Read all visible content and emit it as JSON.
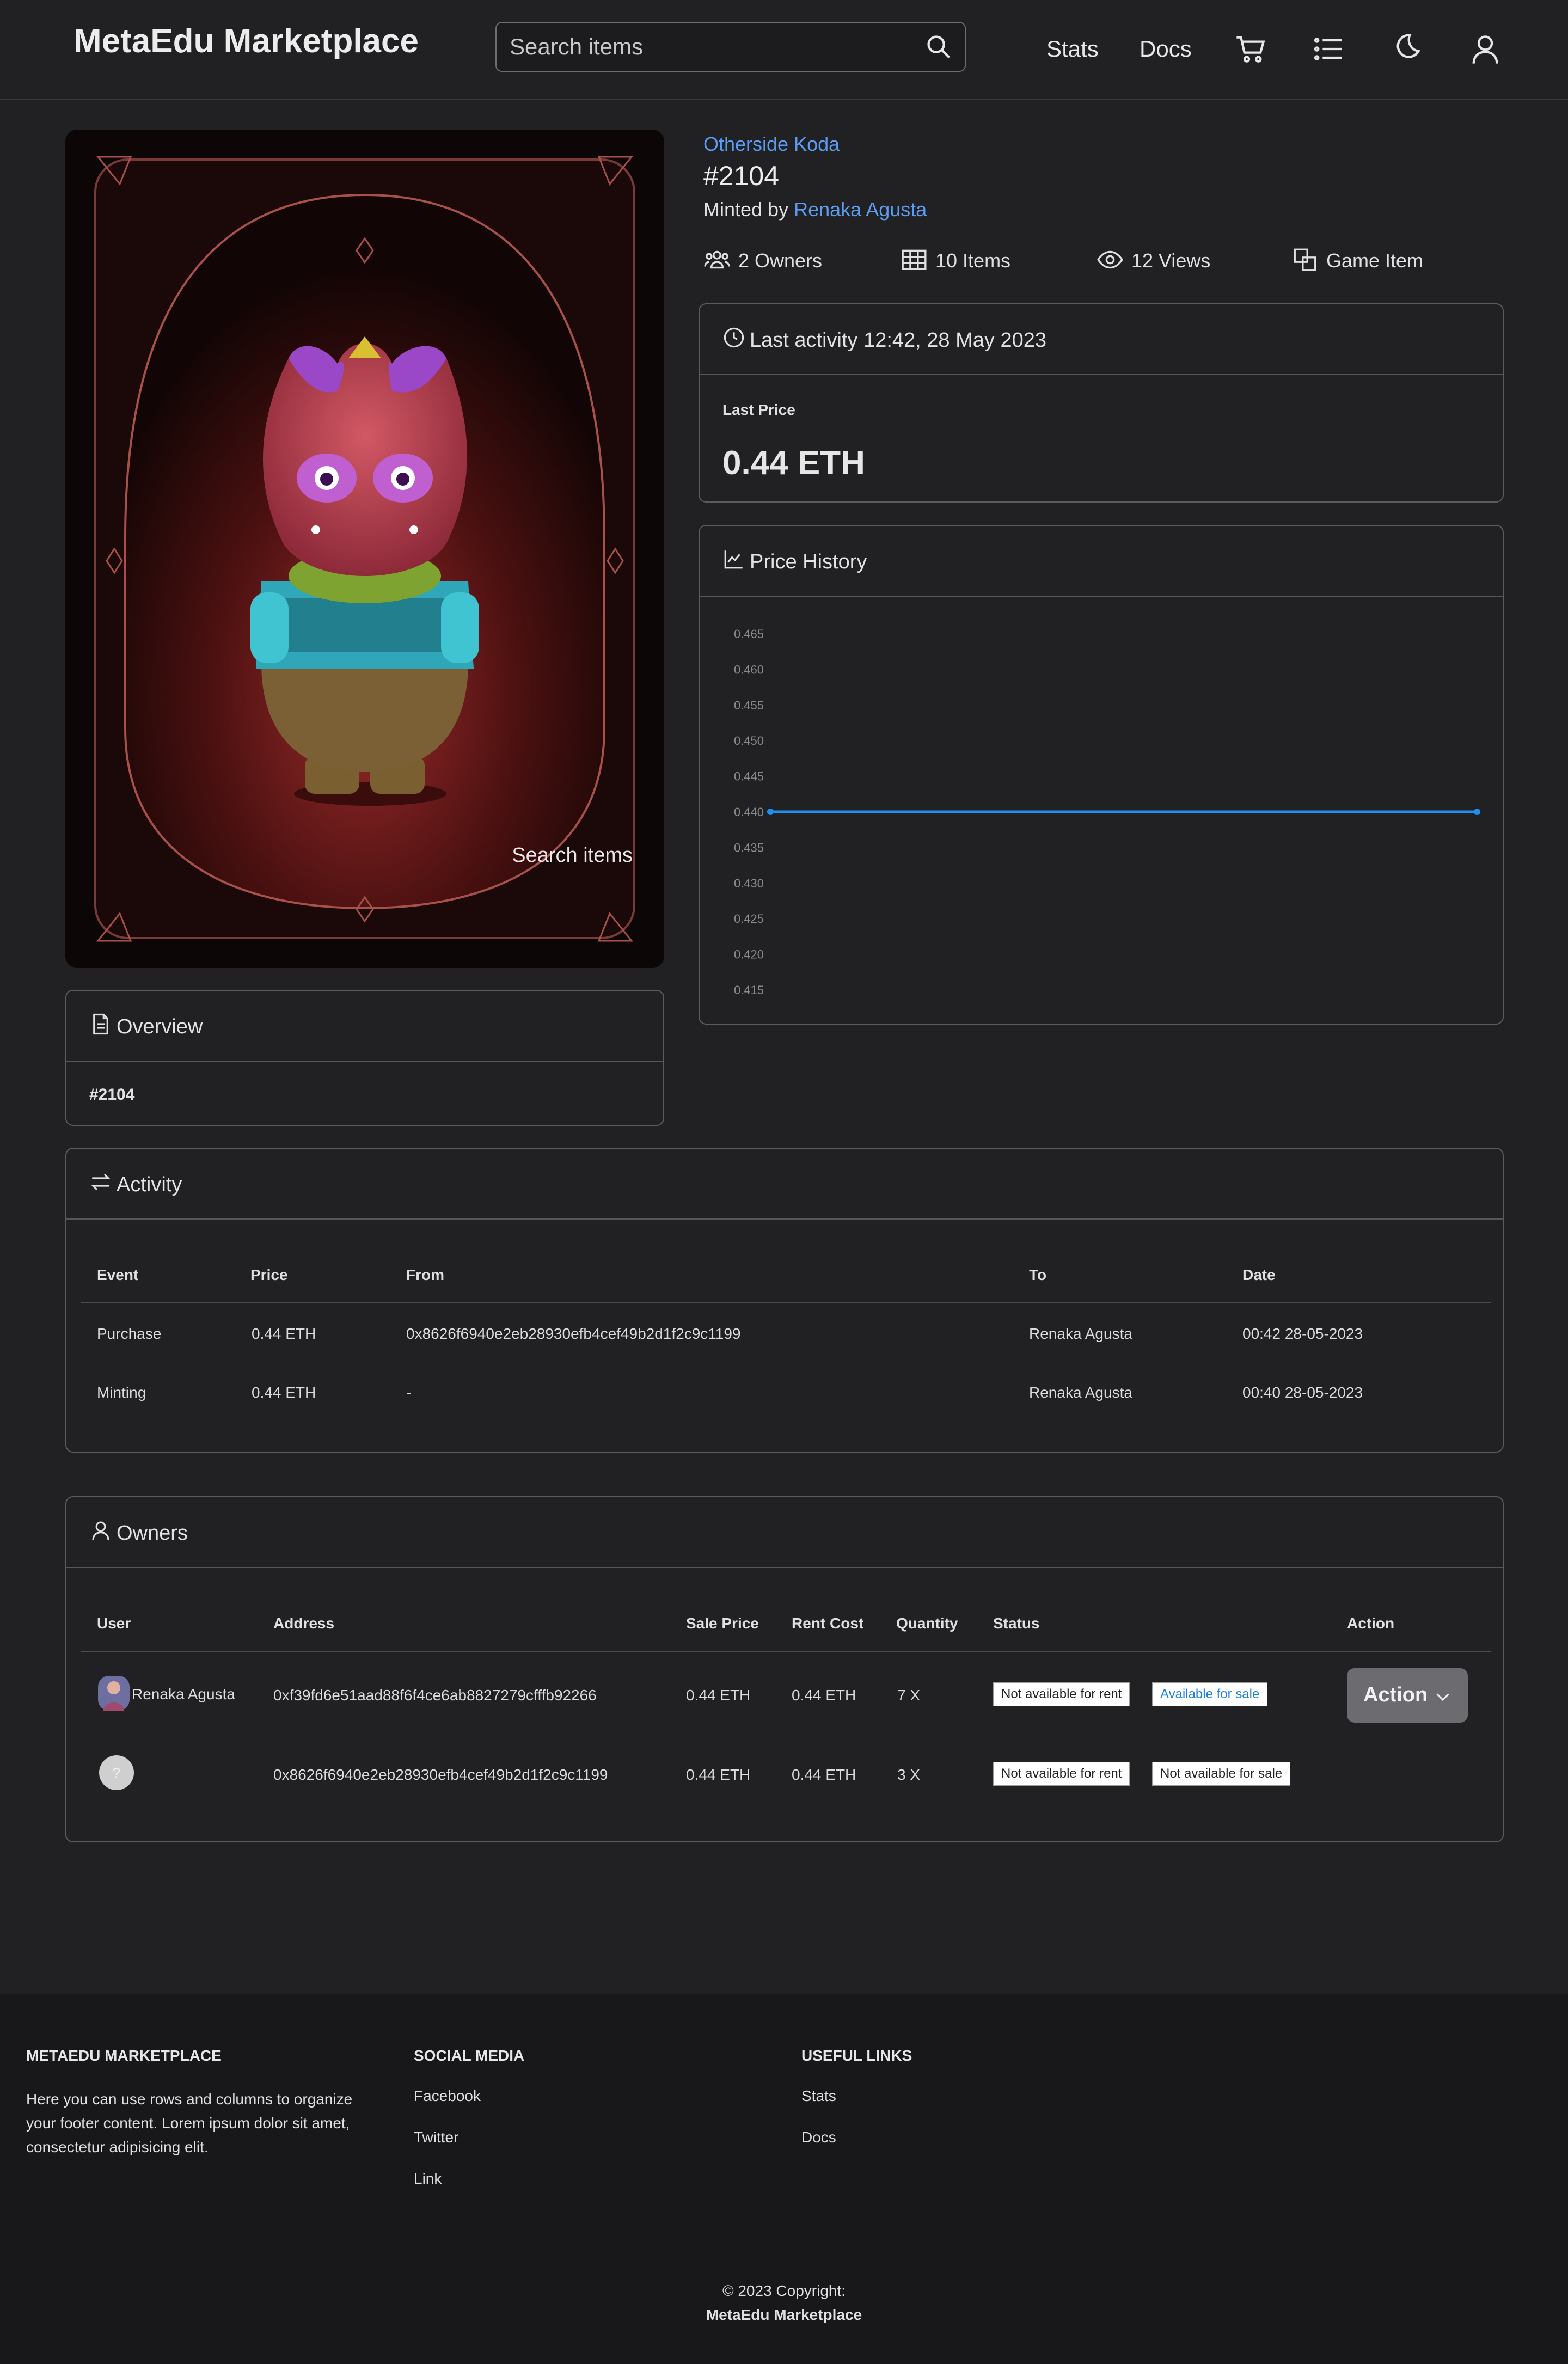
{
  "header": {
    "brand": "MetaEdu Marketplace",
    "search_placeholder": "Search items",
    "nav": {
      "stats": "Stats",
      "docs": "Docs"
    }
  },
  "image_overlay_text": "Search items",
  "item": {
    "collection": "Otherside Koda",
    "title": "#2104",
    "minted_by_label": "Minted by",
    "minted_by_name": "Renaka Agusta",
    "stats": {
      "owners": "2 Owners",
      "items": "10 Items",
      "views": "12 Views",
      "type": "Game Item"
    }
  },
  "last_activity": {
    "heading": "Last activity 12:42, 28 May 2023",
    "price_label": "Last Price",
    "price": "0.44 ETH"
  },
  "price_history": {
    "heading": "Price History"
  },
  "chart_data": {
    "type": "line",
    "title": "",
    "xlabel": "",
    "ylabel": "",
    "ylim": [
      0.415,
      0.465
    ],
    "yticks": [
      "0.465",
      "0.460",
      "0.455",
      "0.450",
      "0.445",
      "0.440",
      "0.435",
      "0.430",
      "0.425",
      "0.420",
      "0.415"
    ],
    "series": [
      {
        "color": "#1e8ff0",
        "values": [
          0.44,
          0.44
        ]
      }
    ],
    "grid": false
  },
  "overview": {
    "heading": "Overview",
    "body": "#2104"
  },
  "activity": {
    "heading": "Activity",
    "columns": [
      "Event",
      "Price",
      "From",
      "To",
      "Date"
    ],
    "rows": [
      {
        "event": "Purchase",
        "price": "0.44 ETH",
        "from": "0x8626f6940e2eb28930efb4cef49b2d1f2c9c1199",
        "to": "Renaka Agusta",
        "date": "00:42 28-05-2023"
      },
      {
        "event": "Minting",
        "price": "0.44 ETH",
        "from": "-",
        "to": "Renaka Agusta",
        "date": "00:40 28-05-2023"
      }
    ]
  },
  "owners": {
    "heading": "Owners",
    "columns": [
      "User",
      "Address",
      "Sale Price",
      "Rent Cost",
      "Quantity",
      "Status",
      "Action"
    ],
    "rows": [
      {
        "user": "Renaka Agusta",
        "address": "0xf39fd6e51aad88f6f4ce6ab8827279cfffb92266",
        "sale_price": "0.44 ETH",
        "rent_cost": "0.44 ETH",
        "quantity": "7 X",
        "rent_status": "Not available for rent",
        "sale_status": "Available for sale",
        "action": "Action"
      },
      {
        "user": "",
        "avatar_text": "?",
        "address": "0x8626f6940e2eb28930efb4cef49b2d1f2c9c1199",
        "sale_price": "0.44 ETH",
        "rent_cost": "0.44 ETH",
        "quantity": "3 X",
        "rent_status": "Not available for rent",
        "sale_status": "Not available for sale"
      }
    ]
  },
  "footer": {
    "col1_heading": "METAEDU MARKETPLACE",
    "col1_text": "Here you can use rows and columns to organize your footer content. Lorem ipsum dolor sit amet, consectetur adipisicing elit.",
    "col2_heading": "SOCIAL MEDIA",
    "col2_links": [
      "Facebook",
      "Twitter",
      "Link"
    ],
    "col3_heading": "USEFUL LINKS",
    "col3_links": [
      "Stats",
      "Docs"
    ],
    "copyright": "© 2023 Copyright:",
    "copyright_name": "MetaEdu Marketplace"
  },
  "colors": {
    "background": "#212124",
    "link": "#5e9cf2",
    "chart_line": "#1e8ff0",
    "footer_bg": "#18181a"
  }
}
